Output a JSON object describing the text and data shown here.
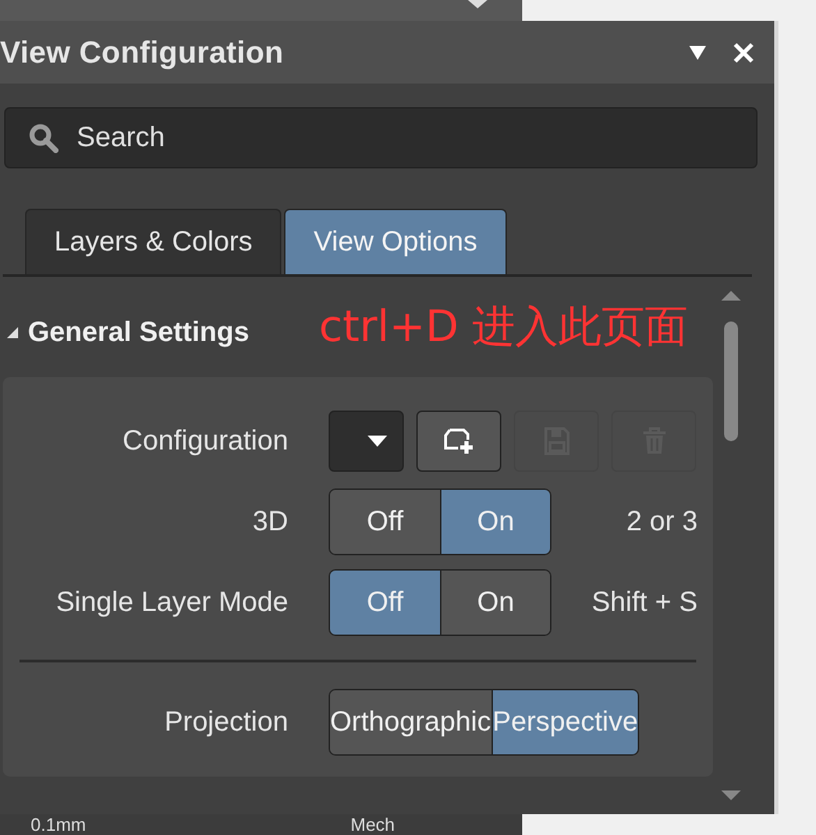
{
  "window": {
    "title": "View Configuration"
  },
  "search": {
    "placeholder": "Search"
  },
  "tabs": [
    {
      "label": "Layers & Colors",
      "selected": false
    },
    {
      "label": "View Options",
      "selected": true
    }
  ],
  "annotation": "ctrl+D  进入此页面",
  "section": {
    "title": "General Settings",
    "expanded": true
  },
  "settings": [
    {
      "kind": "config",
      "label": "Configuration",
      "buttons": [
        {
          "kind": "new",
          "disabled": false
        },
        {
          "kind": "save",
          "disabled": true
        },
        {
          "kind": "delete",
          "disabled": true
        }
      ]
    },
    {
      "kind": "toggle",
      "label": "3D",
      "options": [
        {
          "label": "Off",
          "selected": false
        },
        {
          "label": "On",
          "selected": true
        }
      ],
      "shortcut": "2 or 3"
    },
    {
      "kind": "toggle",
      "label": "Single Layer Mode",
      "options": [
        {
          "label": "Off",
          "selected": true
        },
        {
          "label": "On",
          "selected": false
        }
      ],
      "shortcut": "Shift + S"
    },
    {
      "kind": "toggle",
      "label": "Projection",
      "divider_before": true,
      "options": [
        {
          "label": "Orthographic",
          "selected": false
        },
        {
          "label": "Perspective",
          "selected": true
        }
      ]
    }
  ],
  "bottom_row": {
    "column_1": "0.1mm",
    "column_2": "Mech"
  }
}
